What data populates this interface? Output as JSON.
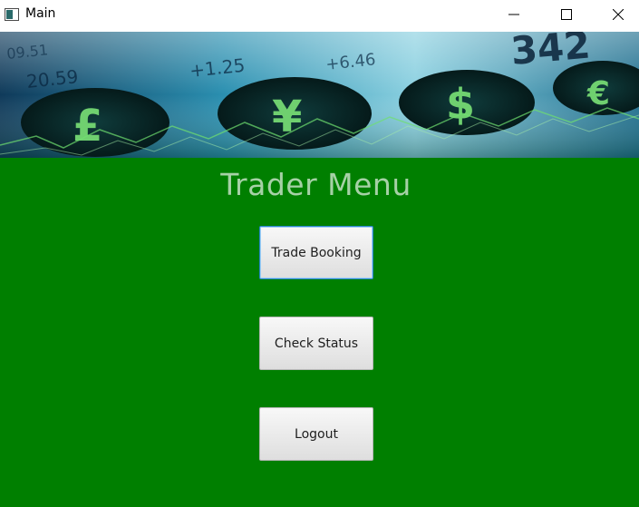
{
  "window": {
    "title": "Main",
    "controls": {
      "minimize_icon": "minimize-icon",
      "maximize_icon": "maximize-icon",
      "close_icon": "close-icon"
    }
  },
  "banner": {
    "numbers": [
      "20.59",
      "+1.25",
      "+6.46",
      "342",
      "09.51"
    ],
    "symbols": [
      "£",
      "¥",
      "$",
      "€"
    ]
  },
  "main": {
    "heading": "Trader Menu",
    "buttons": [
      {
        "label": "Trade Booking",
        "focused": true
      },
      {
        "label": "Check Status",
        "focused": false
      },
      {
        "label": "Logout",
        "focused": false
      }
    ]
  },
  "colors": {
    "background": "#007f00",
    "heading": "#a6d1a6",
    "focus_border": "#2a86c8"
  }
}
